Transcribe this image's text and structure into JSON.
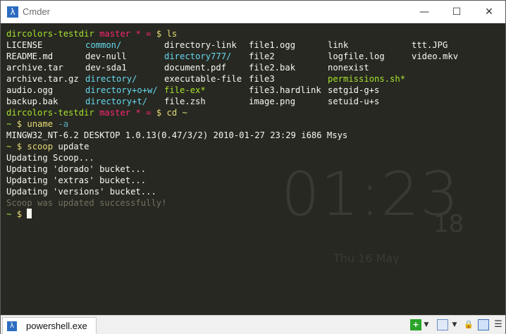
{
  "window": {
    "title": "Cmder",
    "app_icon": "λ",
    "controls": {
      "minimize": "—",
      "maximize": "☐",
      "close": "✕"
    }
  },
  "prompt": {
    "path": "dircolors-testdir",
    "branch": "master * =",
    "home": "~",
    "dollar": "$"
  },
  "commands": {
    "ls": "ls",
    "cd": "cd ~",
    "uname": "uname",
    "uname_flag": "-a",
    "scoop": "scoop",
    "scoop_arg": "update"
  },
  "ls_output": {
    "col1": [
      "LICENSE",
      "README.md",
      "archive.tar",
      "archive.tar.gz",
      "audio.ogg",
      "backup.bak"
    ],
    "col2": [
      "common/",
      "dev-null",
      "dev-sda1",
      "directory/",
      "directory+o+w/",
      "directory+t/"
    ],
    "col3": [
      "directory-link",
      "directory777/",
      "document.pdf",
      "executable-file",
      "file-ex*",
      "file.zsh"
    ],
    "col4": [
      "file1.ogg",
      "file2",
      "file2.bak",
      "file3",
      "file3.hardlink",
      "image.png"
    ],
    "col5": [
      "link",
      "logfile.log",
      "nonexist",
      "permissions.sh*",
      "setgid-g+s",
      "setuid-u+s"
    ],
    "col6": [
      "ttt.JPG",
      "video.mkv"
    ]
  },
  "uname_output": "MINGW32_NT-6.2 DESKTOP 1.0.13(0.47/3/2) 2010-01-27 23:29 i686 Msys",
  "scoop_output": [
    "Updating Scoop...",
    "Updating 'dorado' bucket...",
    "Updating 'extras' bucket...",
    "Updating 'versions' bucket..."
  ],
  "scoop_success": "Scoop was updated successfully!",
  "clock": {
    "time": "01:23",
    "seconds": "18",
    "date": "Thu 16 May"
  },
  "status": {
    "tab_label": "powershell.exe",
    "add_icon": "+",
    "dropdown": "▼",
    "lock_icon": "🔒",
    "menu_icon": "☰"
  },
  "colors": {
    "background": "#272822",
    "prompt_path": "#a6e22e",
    "prompt_branch": "#f92672",
    "dollar": "#e6db74",
    "directory": "#66d9ef",
    "executable": "#a6e22e",
    "success": "#75715e"
  }
}
